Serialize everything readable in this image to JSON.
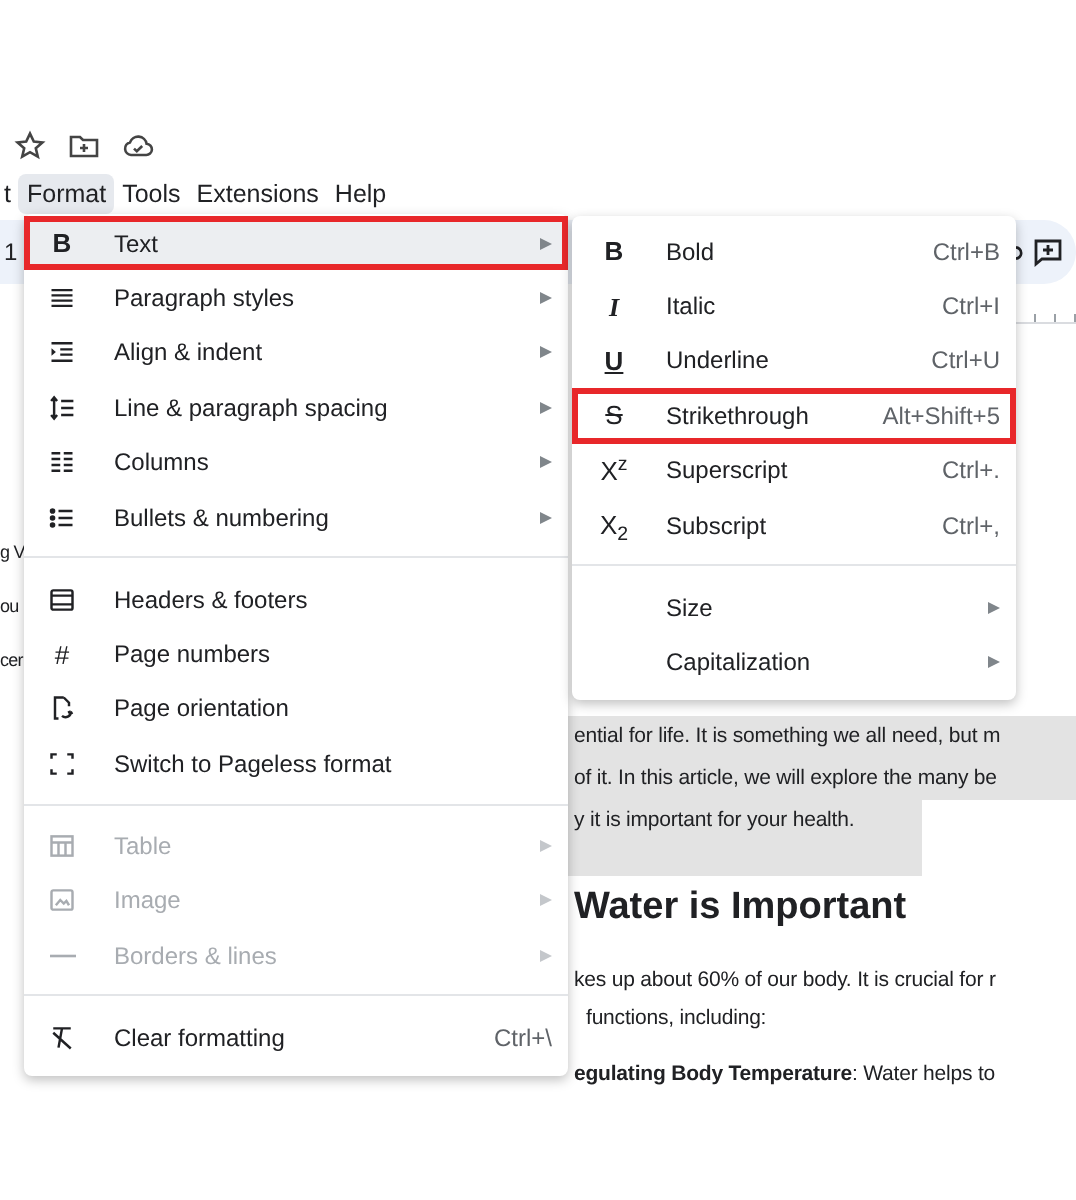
{
  "menu_bar": [
    {
      "label": "t",
      "selected": false
    },
    {
      "label": "Format",
      "selected": true
    },
    {
      "label": "Tools",
      "selected": false
    },
    {
      "label": "Extensions",
      "selected": false
    },
    {
      "label": "Help",
      "selected": false
    }
  ],
  "toolbar": {
    "font_size": "1"
  },
  "document": {
    "left_fragments": [
      "g V",
      "ou",
      "cer"
    ],
    "selected_lines": [
      "ential for life. It is something we all need, but m",
      "of it. In this article, we will explore the many be",
      "y it is important for your health."
    ],
    "heading": "Water is Important",
    "paragraph_lines": [
      "kes up about 60% of our body. It is crucial for r",
      "functions, including:"
    ],
    "list_item": "**egulating Body Temperature**: Water helps to"
  },
  "format_menu": {
    "sections": [
      [
        {
          "label": "Text",
          "glyph": "B",
          "submenu": true,
          "disabled": false,
          "selected": true,
          "outlined": true
        },
        {
          "label": "Paragraph styles",
          "submenu": true,
          "disabled": false,
          "selected": false,
          "outlined": false
        },
        {
          "label": "Align & indent",
          "submenu": true,
          "disabled": false,
          "selected": false,
          "outlined": false
        },
        {
          "label": "Line & paragraph spacing",
          "submenu": true,
          "disabled": false,
          "selected": false,
          "outlined": false
        },
        {
          "label": "Columns",
          "submenu": true,
          "disabled": false,
          "selected": false,
          "outlined": false
        },
        {
          "label": "Bullets & numbering",
          "submenu": true,
          "disabled": false,
          "selected": false,
          "outlined": false
        }
      ],
      [
        {
          "label": "Headers & footers",
          "submenu": false,
          "disabled": false,
          "selected": false,
          "outlined": false
        },
        {
          "label": "Page numbers",
          "glyph": "#",
          "submenu": false,
          "disabled": false,
          "selected": false,
          "outlined": false
        },
        {
          "label": "Page orientation",
          "submenu": false,
          "disabled": false,
          "selected": false,
          "outlined": false
        },
        {
          "label": "Switch to Pageless format",
          "submenu": false,
          "disabled": false,
          "selected": false,
          "outlined": false
        }
      ],
      [
        {
          "label": "Table",
          "submenu": true,
          "disabled": true,
          "selected": false,
          "outlined": false
        },
        {
          "label": "Image",
          "submenu": true,
          "disabled": true,
          "selected": false,
          "outlined": false
        },
        {
          "label": "Borders & lines",
          "submenu": true,
          "disabled": true,
          "selected": false,
          "outlined": false
        }
      ],
      [
        {
          "label": "Clear formatting",
          "shortcut": "Ctrl+\\",
          "submenu": false,
          "disabled": false,
          "selected": false,
          "outlined": false
        }
      ]
    ]
  },
  "text_submenu": {
    "sections": [
      [
        {
          "label": "Bold",
          "glyph": "B",
          "shortcut": "Ctrl+B",
          "submenu": false,
          "selected": false,
          "outlined": false
        },
        {
          "label": "Italic",
          "glyph": "I",
          "shortcut": "Ctrl+I",
          "submenu": false,
          "selected": false,
          "outlined": false
        },
        {
          "label": "Underline",
          "glyph": "U",
          "shortcut": "Ctrl+U",
          "submenu": false,
          "selected": false,
          "outlined": false
        },
        {
          "label": "Strikethrough",
          "glyph": "S",
          "shortcut": "Alt+Shift+5",
          "submenu": false,
          "selected": false,
          "outlined": true
        },
        {
          "label": "Superscript",
          "glyph": "X$^{z}$",
          "shortcut": "Ctrl+.",
          "submenu": false,
          "selected": false,
          "outlined": false
        },
        {
          "label": "Subscript",
          "glyph": "X$_{2}$",
          "shortcut": "Ctrl+,",
          "submenu": false,
          "selected": false,
          "outlined": false
        }
      ],
      [
        {
          "label": "Size",
          "submenu": true,
          "selected": false,
          "outlined": false
        },
        {
          "label": "Capitalization",
          "submenu": true,
          "selected": false,
          "outlined": false
        }
      ]
    ]
  }
}
